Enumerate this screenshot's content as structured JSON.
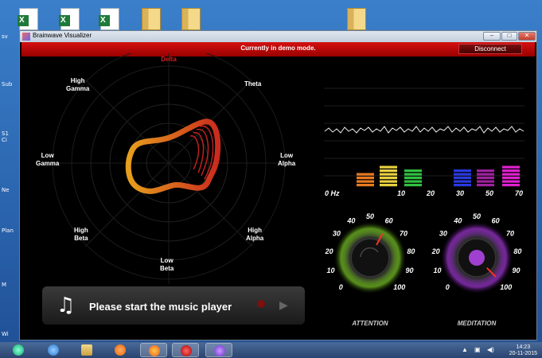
{
  "window": {
    "title": "Brainwave Visualizer"
  },
  "banner": {
    "message": "Currently in demo mode.",
    "disconnect": "Disconnect"
  },
  "radar": {
    "top": "Delta",
    "labels": [
      "High\nGamma",
      "Theta",
      "Low\nGamma",
      "Low\nAlpha",
      "High\nBeta",
      "High\nAlpha",
      "Low\nBeta"
    ]
  },
  "spectrum": {
    "axis_labels": [
      "0 Hz",
      "10",
      "20",
      "30",
      "50",
      "70"
    ],
    "bars": [
      {
        "color": "#e87a20",
        "levels": 4
      },
      {
        "color": "#e8d040",
        "levels": 6
      },
      {
        "color": "#30c040",
        "levels": 5
      },
      {
        "color": "#2a3ae0",
        "levels": 5
      },
      {
        "color": "#a020a0",
        "levels": 5
      },
      {
        "color": "#e020d0",
        "levels": 6
      }
    ]
  },
  "gauges": [
    {
      "name": "ATTENTION",
      "ticks": [
        "10",
        "20",
        "30",
        "40",
        "50",
        "60",
        "70",
        "80",
        "90",
        "100",
        "0"
      ],
      "value": 60,
      "glow": "#9cff30",
      "needle": "#ff3020"
    },
    {
      "name": "MEDITATION",
      "ticks": [
        "10",
        "20",
        "30",
        "40",
        "50",
        "60",
        "70",
        "80",
        "90",
        "100",
        "0"
      ],
      "value": 100,
      "glow": "#c040ff",
      "needle": "#ff3020"
    }
  ],
  "player": {
    "prompt": "Please start the music player"
  },
  "desktop": {
    "left_labels": [
      "sv",
      "Sub",
      "S1\nCi",
      "Ne",
      "Plan",
      "M",
      "Wi"
    ]
  },
  "taskbar": {
    "time": "14:23",
    "date": "20-11-2015"
  }
}
